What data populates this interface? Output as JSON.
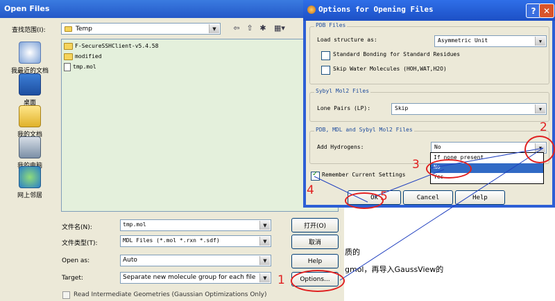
{
  "open_dialog": {
    "title": "Open Files",
    "look_in_label": "查找范围(I):",
    "look_in_value": "Temp",
    "places": [
      {
        "label": "我最近的文档",
        "icon": "recent-documents-icon"
      },
      {
        "label": "桌面",
        "icon": "desktop-icon"
      },
      {
        "label": "我的文档",
        "icon": "my-documents-icon"
      },
      {
        "label": "我的电脑",
        "icon": "my-computer-icon"
      },
      {
        "label": "网上邻居",
        "icon": "network-places-icon"
      }
    ],
    "files": [
      {
        "name": "F-SecureSSHClient-v5.4.58",
        "type": "folder"
      },
      {
        "name": "modified",
        "type": "folder"
      },
      {
        "name": "tmp.mol",
        "type": "file"
      }
    ],
    "filename_label": "文件名(N):",
    "filename_value": "tmp.mol",
    "filetype_label": "文件类型(T):",
    "filetype_value": "MDL Files (*.mol *.rxn *.sdf)",
    "open_as_label": "Open as:",
    "open_as_value": "Auto",
    "target_label": "Target:",
    "target_value": "Separate new molecule group for each file",
    "open_button": "打开(O)",
    "cancel_button": "取消",
    "help_button": "Help",
    "options_button": "Options...",
    "read_intermediate_label": "Read Intermediate Geometries (Gaussian Optimizations Only)"
  },
  "options_dialog": {
    "title": "Options for Opening Files",
    "pdb_group_title": "PDB Files",
    "load_structure_label": "Load structure as:",
    "load_structure_value": "Asymmetric Unit",
    "standard_bonding_label": "Standard Bonding for Standard Residues",
    "skip_water_label": "Skip Water Molecules (HOH,WAT,H2O)",
    "sybyl_group_title": "Sybyl Mol2 Files",
    "lone_pairs_label": "Lone Pairs (LP):",
    "lone_pairs_value": "Skip",
    "pdb_mdl_group_title": "PDB, MDL and Sybyl Mol2 Files",
    "add_hydrogens_label": "Add Hydrogens:",
    "add_hydrogens_value": "No",
    "add_hydrogens_options": [
      "If none present",
      "No",
      "Yes"
    ],
    "remember_settings_label": "Remember Current Settings",
    "ok_button": "Ok",
    "cancel_button": "Cancel",
    "help_button": "Help"
  },
  "annotations": [
    "1",
    "2",
    "3",
    "4",
    "5"
  ],
  "background_text": {
    "line1": "质的",
    "line2": "gmol，再导入GaussView的"
  }
}
